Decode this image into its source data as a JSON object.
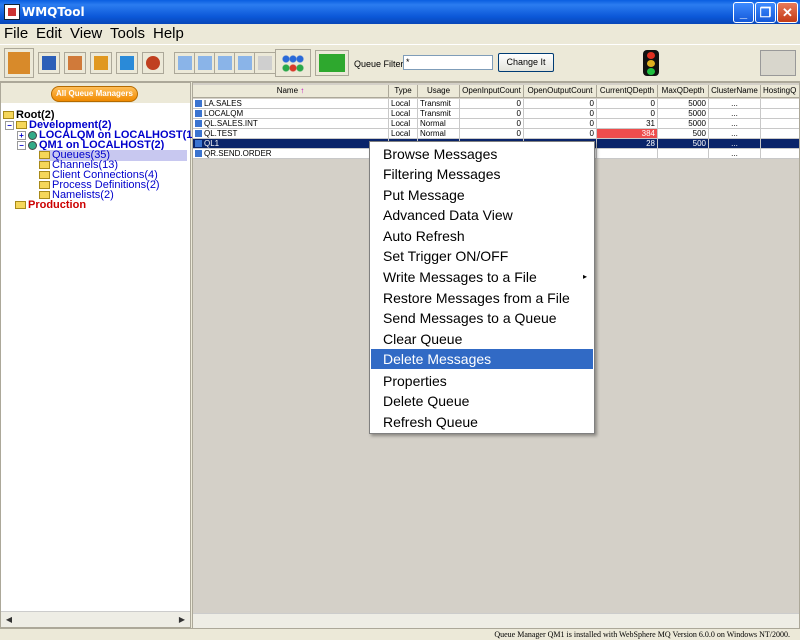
{
  "window": {
    "title": "WMQTool"
  },
  "menu": [
    "File",
    "Edit",
    "View",
    "Tools",
    "Help"
  ],
  "toolbar": {
    "filter_label": "Queue Filter:",
    "filter_value": "*",
    "change_button": "Change It"
  },
  "left": {
    "all_qm_button": "All Queue Managers",
    "tree": [
      {
        "label": "Root(2)",
        "color": "#000000"
      },
      {
        "label": "Development(2)",
        "color": "#0000cc"
      },
      {
        "label": "LOCALQM on LOCALHOST(1",
        "color": "#0000cc"
      },
      {
        "label": "QM1 on LOCALHOST(2)",
        "color": "#0000cc"
      },
      {
        "label": "Queues(35)",
        "color": "#0000cc"
      },
      {
        "label": "Channels(13)",
        "color": "#0000cc"
      },
      {
        "label": "Client Connections(4)",
        "color": "#0000cc"
      },
      {
        "label": "Process Definitions(2)",
        "color": "#0000cc"
      },
      {
        "label": "Namelists(2)",
        "color": "#0000cc"
      },
      {
        "label": "Production",
        "color": "#cc0000"
      }
    ]
  },
  "grid": {
    "columns": [
      "Name",
      "Type",
      "Usage",
      "OpenInputCount",
      "OpenOutputCount",
      "CurrentQDepth",
      "MaxQDepth",
      "ClusterName",
      "HostingQ"
    ],
    "sort_indicator": "↑",
    "rows": [
      {
        "name": "LA.SALES",
        "type": "Local",
        "usage": "Transmit",
        "in": "0",
        "out": "0",
        "depth": "0",
        "max": "5000",
        "cluster": "...",
        "alert": false
      },
      {
        "name": "LOCALQM",
        "type": "Local",
        "usage": "Transmit",
        "in": "0",
        "out": "0",
        "depth": "0",
        "max": "5000",
        "cluster": "...",
        "alert": false
      },
      {
        "name": "QL.SALES.INT",
        "type": "Local",
        "usage": "Normal",
        "in": "0",
        "out": "0",
        "depth": "31",
        "max": "5000",
        "cluster": "...",
        "alert": false
      },
      {
        "name": "QL.TEST",
        "type": "Local",
        "usage": "Normal",
        "in": "0",
        "out": "0",
        "depth": "384",
        "max": "500",
        "cluster": "...",
        "alert": true
      },
      {
        "name": "QL1",
        "type": "",
        "usage": "",
        "in": "",
        "out": "",
        "depth": "28",
        "max": "500",
        "cluster": "...",
        "alert": false,
        "selected": true
      },
      {
        "name": "QR.SEND.ORDER",
        "type": "",
        "usage": "",
        "in": "",
        "out": "",
        "depth": "",
        "max": "",
        "cluster": "...",
        "alert": false
      }
    ]
  },
  "context_menu": [
    {
      "label": "Browse Messages"
    },
    {
      "label": "Filtering Messages"
    },
    {
      "label": "Put Message"
    },
    {
      "label": "Advanced Data View"
    },
    {
      "label": "Auto Refresh"
    },
    {
      "label": "Set Trigger ON/OFF"
    },
    {
      "label": "Write Messages to a File",
      "submenu": true
    },
    {
      "label": "Restore Messages from a File"
    },
    {
      "label": "Send Messages to a Queue"
    },
    {
      "label": "Clear Queue"
    },
    {
      "label": "Delete Messages",
      "highlighted": true
    },
    {
      "label": "Properties"
    },
    {
      "label": "Delete Queue"
    },
    {
      "label": "Refresh Queue"
    }
  ],
  "status": "Queue Manager QM1 is installed with WebSphere MQ Version 6.0.0 on Windows NT/2000."
}
